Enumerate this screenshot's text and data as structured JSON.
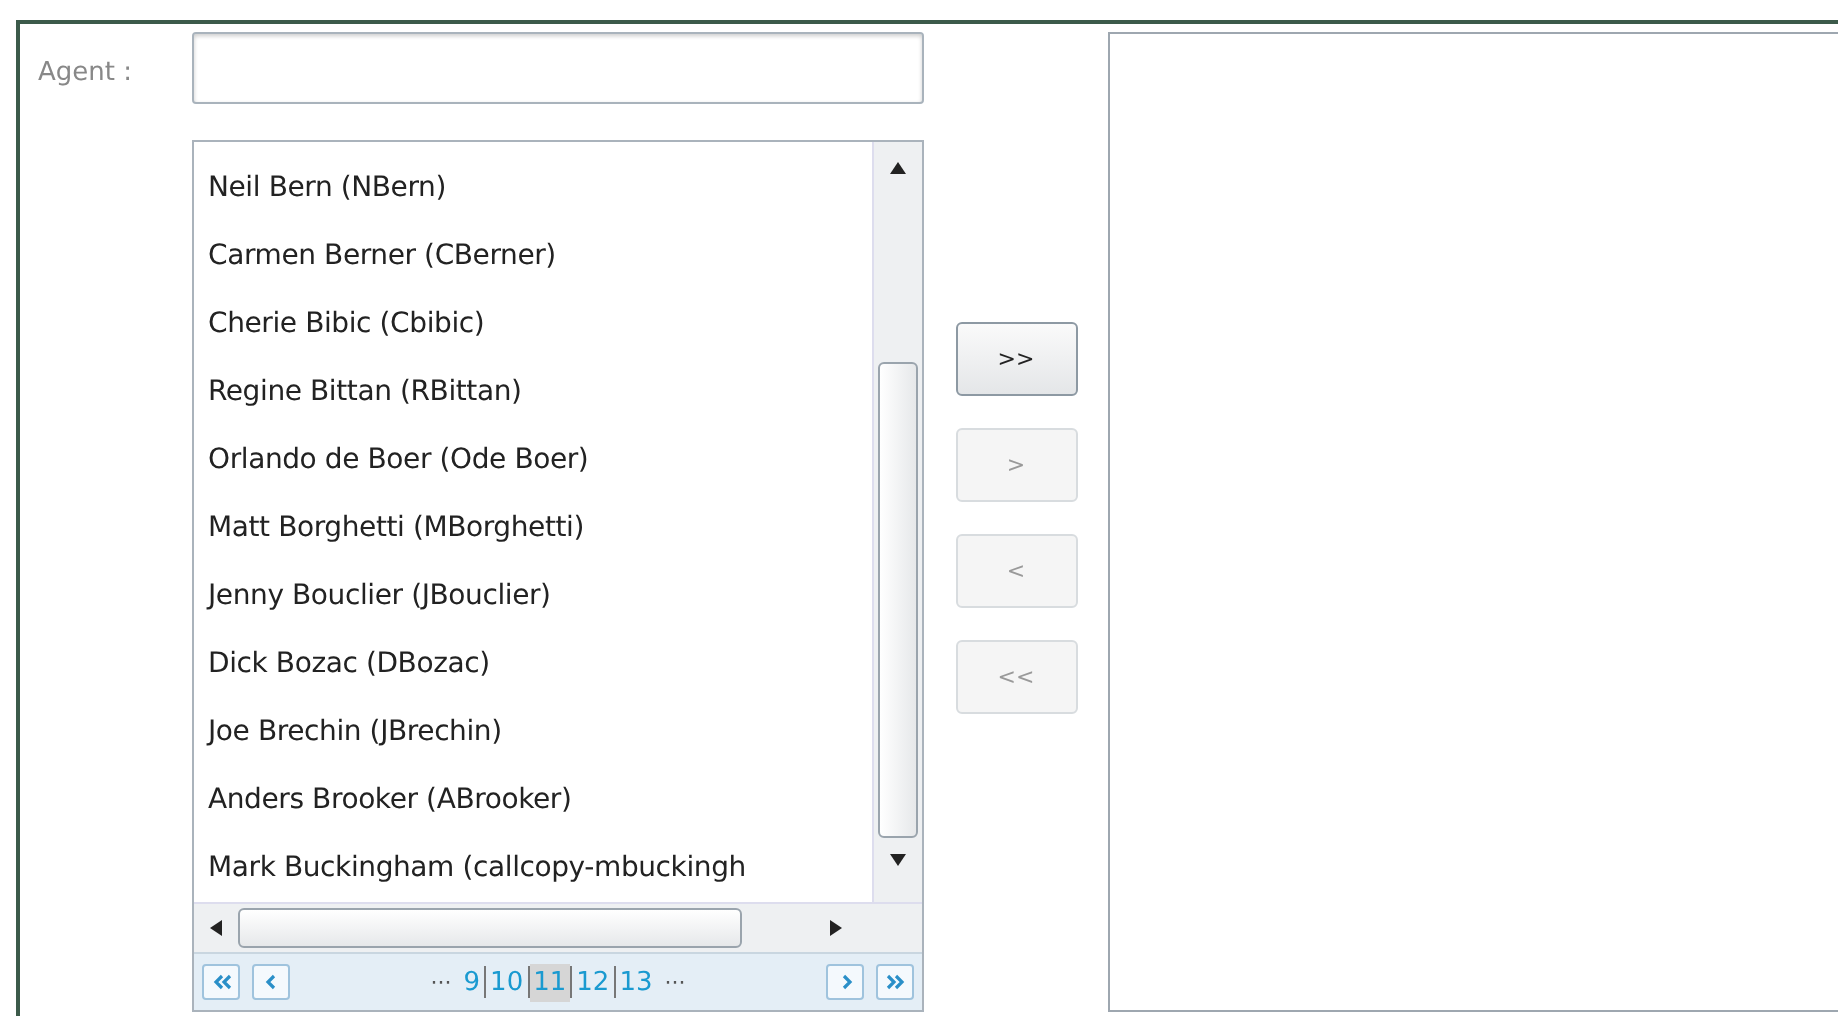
{
  "agent_field": {
    "label": "Agent :"
  },
  "agent_list": {
    "items": [
      {
        "label": "Neil Bern (NBern)"
      },
      {
        "label": "Carmen Berner (CBerner)"
      },
      {
        "label": "Cherie Bibic (Cbibic)"
      },
      {
        "label": "Regine Bittan (RBittan)"
      },
      {
        "label": "Orlando de Boer (Ode Boer)"
      },
      {
        "label": "Matt Borghetti (MBorghetti)"
      },
      {
        "label": "Jenny Bouclier (JBouclier)"
      },
      {
        "label": "Dick Bozac (DBozac)"
      },
      {
        "label": "Joe Brechin (JBrechin)"
      },
      {
        "label": "Anders Brooker (ABrooker)"
      },
      {
        "label": "Mark Buckingham (callcopy-mbuckingh"
      }
    ]
  },
  "pager": {
    "leading": "···",
    "trailing": "···",
    "pages": [
      {
        "label": "9",
        "selected": false
      },
      {
        "label": "10",
        "selected": false
      },
      {
        "label": "11",
        "selected": true
      },
      {
        "label": "12",
        "selected": false
      },
      {
        "label": "13",
        "selected": false
      }
    ]
  },
  "transfer_buttons": [
    {
      "label": ">>",
      "disabled": false
    },
    {
      "label": ">",
      "disabled": true
    },
    {
      "label": "<",
      "disabled": true
    },
    {
      "label": "<<",
      "disabled": true
    }
  ]
}
